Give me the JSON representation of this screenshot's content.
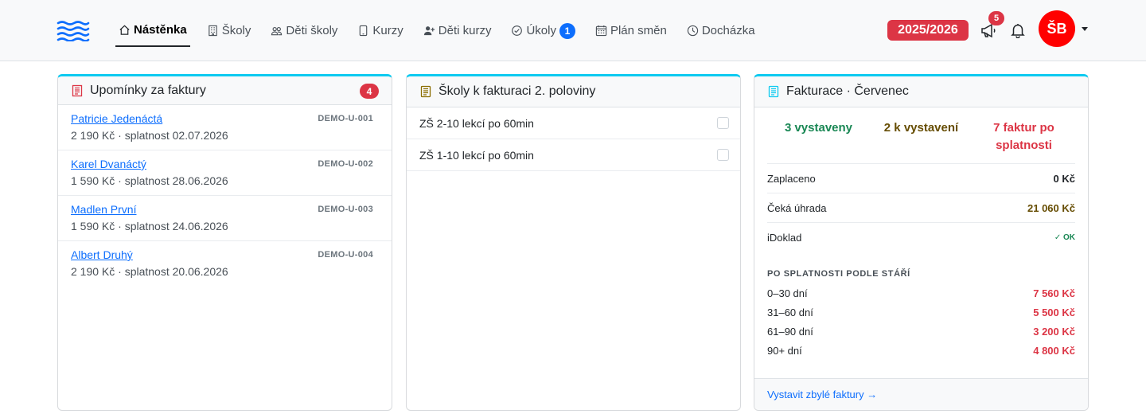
{
  "nav": {
    "items": [
      {
        "label": "Nástěnka",
        "icon": "house-icon"
      },
      {
        "label": "Školy",
        "icon": "building-icon"
      },
      {
        "label": "Děti školy",
        "icon": "people-icon"
      },
      {
        "label": "Kurzy",
        "icon": "tablet-icon"
      },
      {
        "label": "Děti kurzy",
        "icon": "person-plus-icon"
      },
      {
        "label": "Úkoly",
        "icon": "check-circle-icon",
        "badge": "1"
      },
      {
        "label": "Plán směn",
        "icon": "calendar-icon"
      },
      {
        "label": "Docházka",
        "icon": "clock-icon"
      }
    ],
    "year": "2025/2026",
    "notifications_badge": "5",
    "avatar_initials": "ŠB"
  },
  "reminders": {
    "title": "Upomínky za faktury",
    "count": "4",
    "items": [
      {
        "name": "Patricie Jedenáctá",
        "code": "DEMO-U-001",
        "detail": "2 190 Kč · splatnost 02.07.2026"
      },
      {
        "name": "Karel Dvanáctý",
        "code": "DEMO-U-002",
        "detail": "1 590 Kč · splatnost 28.06.2026"
      },
      {
        "name": "Madlen První",
        "code": "DEMO-U-003",
        "detail": "1 590 Kč · splatnost 24.06.2026"
      },
      {
        "name": "Albert Druhý",
        "code": "DEMO-U-004",
        "detail": "2 190 Kč · splatnost 20.06.2026"
      }
    ]
  },
  "schools": {
    "title": "Školy k fakturaci 2. poloviny",
    "items": [
      {
        "label": "ZŠ 2-10 lekcí po 60min",
        "checked": false
      },
      {
        "label": "ZŠ 1-10 lekcí po 60min",
        "checked": false
      }
    ]
  },
  "billing": {
    "title": "Fakturace · Červenec",
    "stats": {
      "issued": "3 vystaveny",
      "to_issue": "2 k vystavení",
      "overdue_line1": "7 faktur po",
      "overdue_line2": "splatnosti"
    },
    "paid_label": "Zaplaceno",
    "paid_value": "0 Kč",
    "pending_label": "Čeká úhrada",
    "pending_value": "21 060 Kč",
    "idoklad_label": "iDoklad",
    "idoklad_status": "✓ OK",
    "aging_label": "PO SPLATNOSTI PODLE STÁŘÍ",
    "aging": [
      {
        "label": "0–30 dní",
        "value": "7 560 Kč"
      },
      {
        "label": "31–60 dní",
        "value": "5 500 Kč"
      },
      {
        "label": "61–90 dní",
        "value": "3 200 Kč"
      },
      {
        "label": "90+ dní",
        "value": "4 800 Kč"
      }
    ],
    "footer_link": "Vystavit zbylé faktury →"
  },
  "colors": {
    "accent": "#0dcaf0",
    "primary": "#0d6efd",
    "danger": "#dc3545",
    "success": "#198754",
    "warning_text": "#664d03",
    "avatar": "#ff0000"
  }
}
